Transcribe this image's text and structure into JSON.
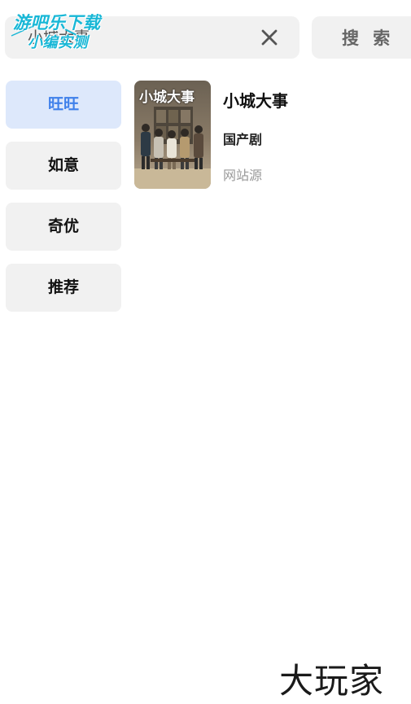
{
  "watermark_top": {
    "line1": "游吧乐下载",
    "line2": "小编实测"
  },
  "search": {
    "value": "小城大事",
    "button_label": "搜 索"
  },
  "sources": [
    {
      "label": "旺旺",
      "active": true
    },
    {
      "label": "如意",
      "active": false
    },
    {
      "label": "奇优",
      "active": false
    },
    {
      "label": "推荐",
      "active": false
    }
  ],
  "result": {
    "poster_text": "小城大事",
    "title": "小城大事",
    "category": "国产剧",
    "source": "网站源"
  },
  "watermark_bottom": "大玩家",
  "colors": {
    "accent": "#3f80ea",
    "active_bg": "#dde8fb",
    "item_bg": "#f1f1f1",
    "watermark": "#18b7d6"
  },
  "icons": {
    "clear": "close-icon"
  }
}
